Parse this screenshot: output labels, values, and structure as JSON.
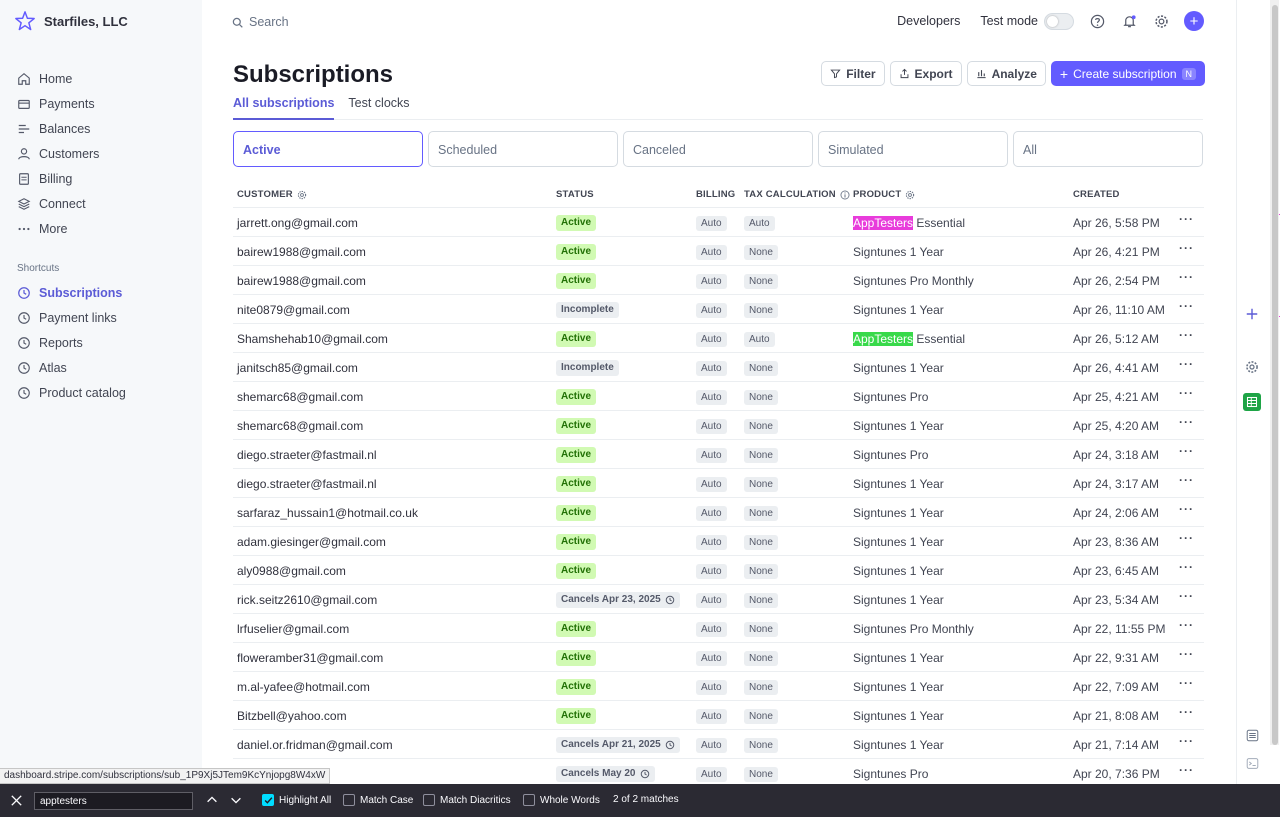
{
  "brand": {
    "name": "Starfiles, LLC"
  },
  "nav": [
    {
      "label": "Home",
      "icon": "home-icon"
    },
    {
      "label": "Payments",
      "icon": "payments-icon"
    },
    {
      "label": "Balances",
      "icon": "balances-icon"
    },
    {
      "label": "Customers",
      "icon": "customers-icon"
    },
    {
      "label": "Billing",
      "icon": "billing-icon"
    },
    {
      "label": "Connect",
      "icon": "connect-icon"
    },
    {
      "label": "More",
      "icon": "more-icon"
    }
  ],
  "shortcuts": {
    "heading": "Shortcuts",
    "items": [
      {
        "label": "Subscriptions",
        "icon": "clock-icon"
      },
      {
        "label": "Payment links",
        "icon": "clock-icon"
      },
      {
        "label": "Reports",
        "icon": "clock-icon"
      },
      {
        "label": "Atlas",
        "icon": "clock-icon"
      },
      {
        "label": "Product catalog",
        "icon": "clock-icon"
      }
    ]
  },
  "topbar": {
    "search_placeholder": "Search",
    "developers": "Developers",
    "test_mode": "Test mode"
  },
  "page": {
    "title": "Subscriptions",
    "actions": {
      "filter": "Filter",
      "export": "Export",
      "analyze": "Analyze",
      "create": "Create subscription",
      "create_shortcut": "N"
    },
    "tabs": [
      "All subscriptions",
      "Test clocks"
    ],
    "filters": [
      "Active",
      "Scheduled",
      "Canceled",
      "Simulated",
      "All"
    ]
  },
  "table": {
    "columns": {
      "customer": "CUSTOMER",
      "status": "STATUS",
      "billing": "BILLING",
      "tax": "TAX CALCULATION",
      "product": "PRODUCT",
      "created": "CREATED"
    },
    "rows": [
      {
        "customer": "jarrett.ong@gmail.com",
        "status": "Active",
        "billing": "Auto",
        "tax": "Auto",
        "product_hl": "AppTesters",
        "product": " Essential",
        "created": "Apr 26, 5:58 PM"
      },
      {
        "customer": "bairew1988@gmail.com",
        "status": "Active",
        "billing": "Auto",
        "tax": "None",
        "product_hl": "",
        "product": "Signtunes 1 Year",
        "created": "Apr 26, 4:21 PM"
      },
      {
        "customer": "bairew1988@gmail.com",
        "status": "Active",
        "billing": "Auto",
        "tax": "None",
        "product_hl": "",
        "product": "Signtunes Pro Monthly",
        "created": "Apr 26, 2:54 PM"
      },
      {
        "customer": "nite0879@gmail.com",
        "status": "Incomplete",
        "billing": "Auto",
        "tax": "None",
        "product_hl": "",
        "product": "Signtunes 1 Year",
        "created": "Apr 26, 11:10 AM"
      },
      {
        "customer": "Shamshehab10@gmail.com",
        "status": "Active",
        "billing": "Auto",
        "tax": "Auto",
        "product_hl": "AppTesters",
        "product": " Essential",
        "created": "Apr 26, 5:12 AM"
      },
      {
        "customer": "janitsch85@gmail.com",
        "status": "Incomplete",
        "billing": "Auto",
        "tax": "None",
        "product_hl": "",
        "product": "Signtunes 1 Year",
        "created": "Apr 26, 4:41 AM"
      },
      {
        "customer": "shemarc68@gmail.com",
        "status": "Active",
        "billing": "Auto",
        "tax": "None",
        "product_hl": "",
        "product": "Signtunes Pro",
        "created": "Apr 25, 4:21 AM"
      },
      {
        "customer": "shemarc68@gmail.com",
        "status": "Active",
        "billing": "Auto",
        "tax": "None",
        "product_hl": "",
        "product": "Signtunes 1 Year",
        "created": "Apr 25, 4:20 AM"
      },
      {
        "customer": "diego.straeter@fastmail.nl",
        "status": "Active",
        "billing": "Auto",
        "tax": "None",
        "product_hl": "",
        "product": "Signtunes Pro",
        "created": "Apr 24, 3:18 AM"
      },
      {
        "customer": "diego.straeter@fastmail.nl",
        "status": "Active",
        "billing": "Auto",
        "tax": "None",
        "product_hl": "",
        "product": "Signtunes 1 Year",
        "created": "Apr 24, 3:17 AM"
      },
      {
        "customer": "sarfaraz_hussain1@hotmail.co.uk",
        "status": "Active",
        "billing": "Auto",
        "tax": "None",
        "product_hl": "",
        "product": "Signtunes 1 Year",
        "created": "Apr 24, 2:06 AM"
      },
      {
        "customer": "adam.giesinger@gmail.com",
        "status": "Active",
        "billing": "Auto",
        "tax": "None",
        "product_hl": "",
        "product": "Signtunes 1 Year",
        "created": "Apr 23, 8:36 AM"
      },
      {
        "customer": "aly0988@gmail.com",
        "status": "Active",
        "billing": "Auto",
        "tax": "None",
        "product_hl": "",
        "product": "Signtunes 1 Year",
        "created": "Apr 23, 6:45 AM"
      },
      {
        "customer": "rick.seitz2610@gmail.com",
        "status": "Cancels Apr 23, 2025",
        "billing": "Auto",
        "tax": "None",
        "product_hl": "",
        "product": "Signtunes 1 Year",
        "created": "Apr 23, 5:34 AM"
      },
      {
        "customer": "lrfuselier@gmail.com",
        "status": "Active",
        "billing": "Auto",
        "tax": "None",
        "product_hl": "",
        "product": "Signtunes Pro Monthly",
        "created": "Apr 22, 11:55 PM"
      },
      {
        "customer": "floweramber31@gmail.com",
        "status": "Active",
        "billing": "Auto",
        "tax": "None",
        "product_hl": "",
        "product": "Signtunes 1 Year",
        "created": "Apr 22, 9:31 AM"
      },
      {
        "customer": "m.al-yafee@hotmail.com",
        "status": "Active",
        "billing": "Auto",
        "tax": "None",
        "product_hl": "",
        "product": "Signtunes 1 Year",
        "created": "Apr 22, 7:09 AM"
      },
      {
        "customer": "Bitzbell@yahoo.com",
        "status": "Active",
        "billing": "Auto",
        "tax": "None",
        "product_hl": "",
        "product": "Signtunes 1 Year",
        "created": "Apr 21, 8:08 AM"
      },
      {
        "customer": "daniel.or.fridman@gmail.com",
        "status": "Cancels Apr 21, 2025",
        "billing": "Auto",
        "tax": "None",
        "product_hl": "",
        "product": "Signtunes 1 Year",
        "created": "Apr 21, 7:14 AM"
      },
      {
        "customer": "@gmail.com",
        "status": "Cancels May 20",
        "billing": "Auto",
        "tax": "None",
        "product_hl": "",
        "product": "Signtunes Pro",
        "created": "Apr 20, 7:36 PM"
      }
    ]
  },
  "status_url": "dashboard.stripe.com/subscriptions/sub_1P9Xj5JTem9KcYnjopg8W4xW",
  "findbar": {
    "query": "apptesters",
    "highlight_all": "Highlight All",
    "match_case": "Match Case",
    "match_diacritics": "Match Diacritics",
    "whole_words": "Whole Words",
    "count": "2 of 2 matches"
  },
  "colors": {
    "accent": "#635bff",
    "active_badge_bg": "#d1fab3",
    "active_badge_text": "#217005",
    "highlight_current": "#e83cdb",
    "highlight_other": "#38d94a"
  }
}
